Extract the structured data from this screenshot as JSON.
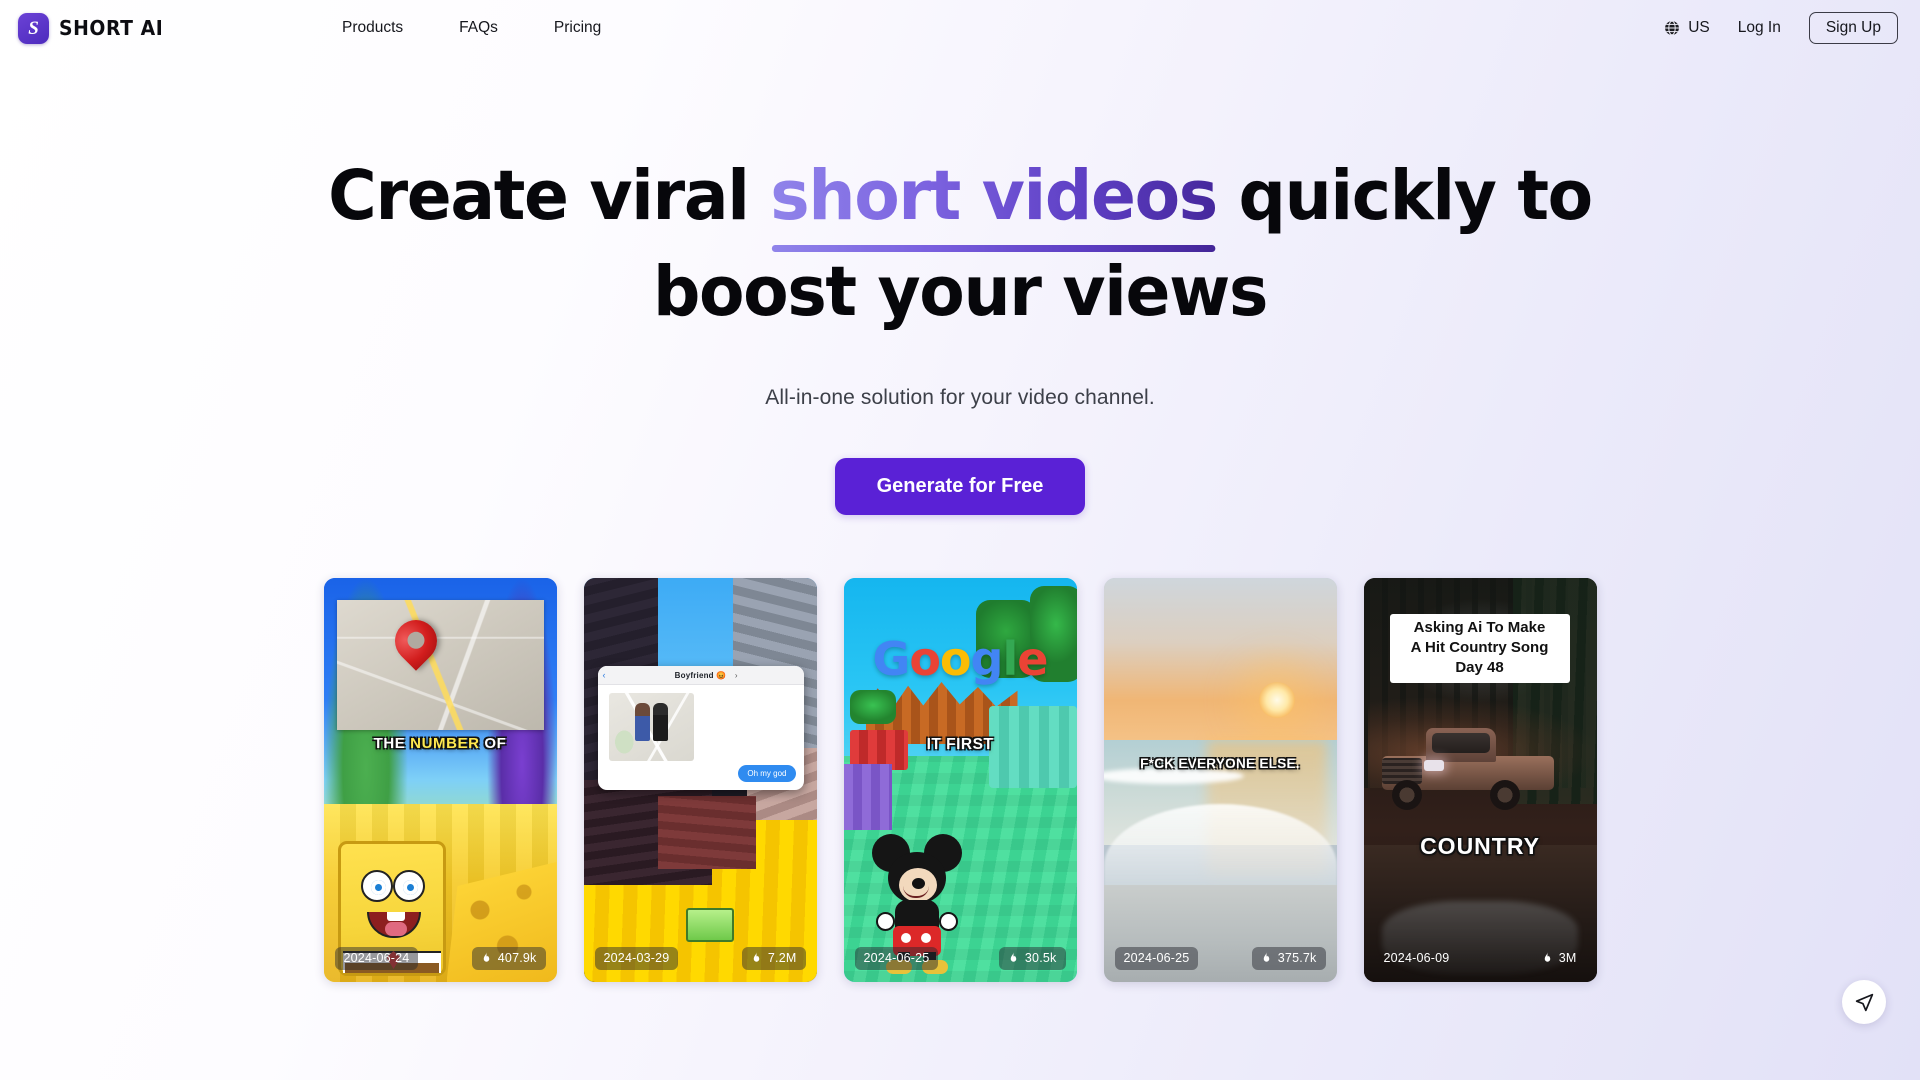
{
  "brand": {
    "mark_letter": "S",
    "name": "SHORT AI",
    "mark_color": "#5a21d6"
  },
  "nav": {
    "items": [
      {
        "label": "Products"
      },
      {
        "label": "FAQs"
      },
      {
        "label": "Pricing"
      }
    ],
    "locale": {
      "icon": "globe-icon",
      "label": "US"
    },
    "login_label": "Log In",
    "signup_label": "Sign Up"
  },
  "hero": {
    "headline_part1": "Create viral ",
    "headline_accent": "short videos",
    "headline_part2": " quickly to",
    "headline_line2": "boost your views",
    "accent_gradient_from": "#9084ea",
    "accent_gradient_to": "#45279c",
    "subhead": "All-in-one solution for your video channel.",
    "cta_label": "Generate for Free",
    "cta_color": "#5a21d6"
  },
  "cards": [
    {
      "name": "spongebob-map",
      "caption_a": "THE ",
      "caption_b": "NUMBER",
      "caption_c": " OF",
      "date": "2024-06-24",
      "views": "407.9k",
      "views_icon": "flame-icon"
    },
    {
      "name": "minecraft-chat",
      "chat_title": "Boyfriend 😡",
      "chat_back": "‹",
      "chat_forward": "›",
      "chat_bubble": "Oh my god",
      "date": "2024-03-29",
      "views": "7.2M",
      "views_icon": "flame-icon"
    },
    {
      "name": "google-mickey",
      "logo_letters": [
        "G",
        "o",
        "o",
        "g",
        "l",
        "e"
      ],
      "caption": "IT FIRST",
      "date": "2024-06-25",
      "views": "30.5k",
      "views_icon": "flame-icon"
    },
    {
      "name": "beach-sunset",
      "caption": "F*CK EVERYONE ELSE.",
      "date": "2024-06-25",
      "views": "375.7k",
      "views_icon": "flame-icon"
    },
    {
      "name": "country-truck",
      "title_line1": "Asking Ai To Make",
      "title_line2": "A Hit Country Song",
      "title_line3": "Day 48",
      "caption": "COUNTRY",
      "date": "2024-06-09",
      "views": "3M",
      "views_icon": "flame-icon"
    }
  ],
  "fab": {
    "icon": "send-arrow-icon"
  }
}
